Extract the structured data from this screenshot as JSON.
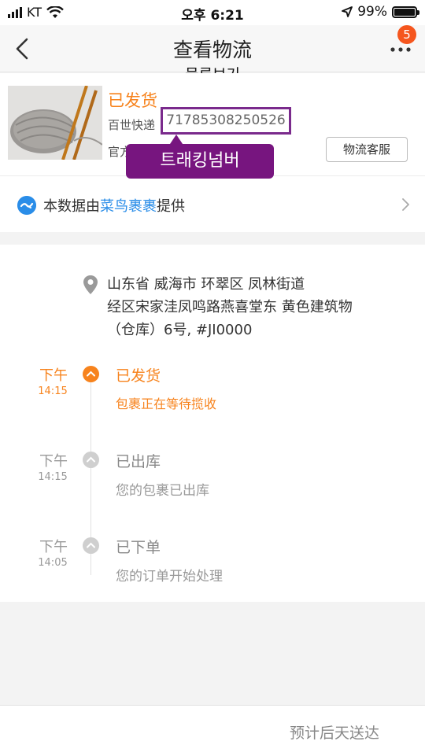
{
  "status_bar": {
    "carrier": "KT",
    "time": "오후 6:21",
    "battery": "99%",
    "battery_level": 0.99
  },
  "nav": {
    "title": "查看物流",
    "badge_count": "5",
    "subtitle_kr": "물류보기",
    "icons": {
      "back": "chevron-left-icon",
      "more": "more-dots-icon"
    }
  },
  "package": {
    "status": "已发货",
    "courier": "百世快递",
    "tracking_number": "71785308250526",
    "official_label": "官方",
    "tracking_tag_kr": "트래킹넘버",
    "service_button": "物流客服"
  },
  "provider": {
    "prefix": "本数据由",
    "name": "菜鸟裹裹",
    "suffix": "提供",
    "accent": "#2a8de8"
  },
  "address": {
    "line1": "山东省 威海市 环翠区 凤林街道",
    "line2": "经区宋家洼凤鸣路燕喜堂东 黄色建筑物",
    "line3": "（仓库）6号, #JI0000"
  },
  "timeline": [
    {
      "period": "下午",
      "time": "14:15",
      "title": "已发货",
      "desc": "包裹正在等待揽收",
      "active": true
    },
    {
      "period": "下午",
      "time": "14:15",
      "title": "已出库",
      "desc": "您的包裹已出库",
      "active": false
    },
    {
      "period": "下午",
      "time": "14:05",
      "title": "已下单",
      "desc": "您的订单开始处理",
      "active": false
    }
  ],
  "footer": {
    "eta": "预计后天送达"
  },
  "colors": {
    "accent_orange": "#f7831d",
    "annotation_purple": "#77157f",
    "badge_red": "#f5561e"
  }
}
